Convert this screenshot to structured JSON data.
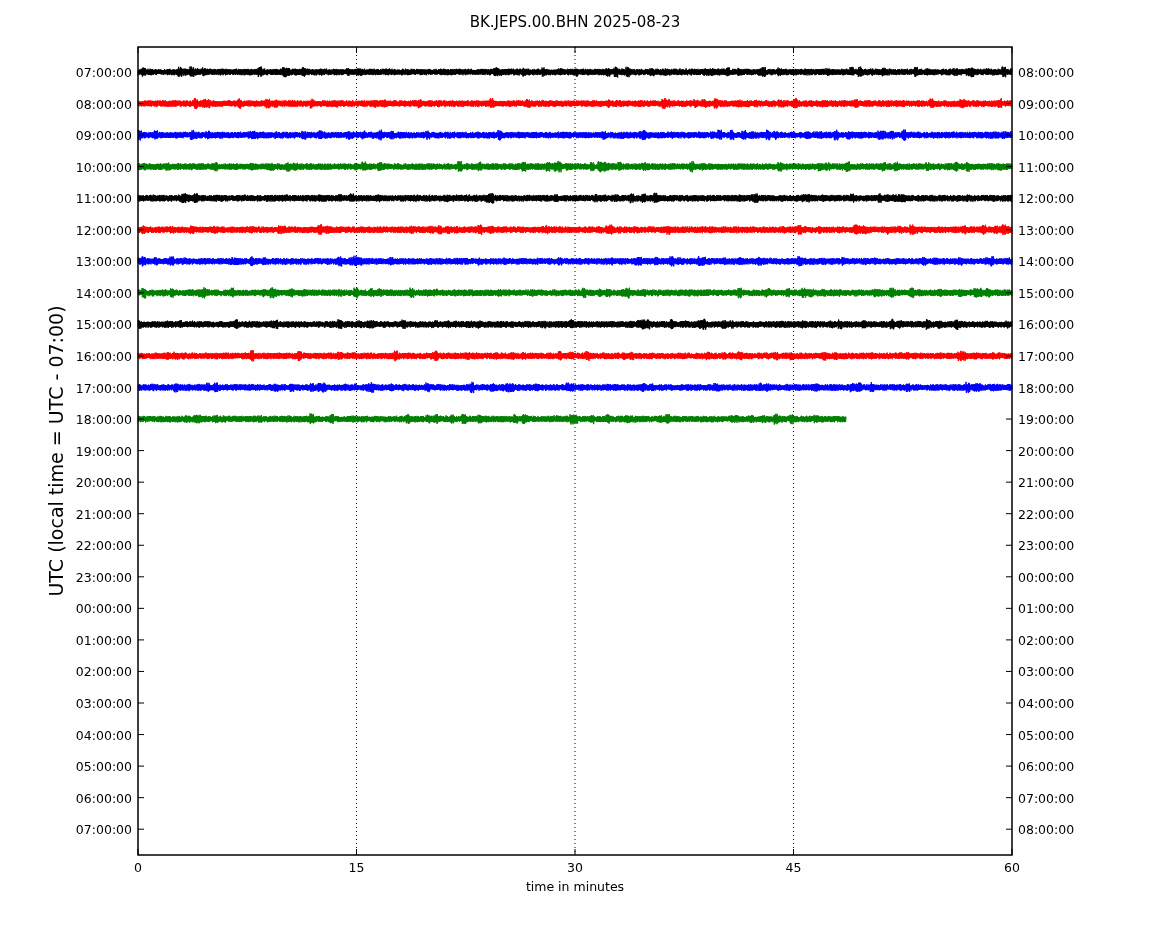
{
  "title": "BK.JEPS.00.BHN 2025-08-23",
  "y_axis_label": "UTC (local time = UTC - 07:00)",
  "x_axis_label": "time in minutes",
  "x_ticks": [
    "0",
    "15",
    "30",
    "45",
    "60"
  ],
  "left_labels": [
    "07:00:00",
    "08:00:00",
    "09:00:00",
    "10:00:00",
    "11:00:00",
    "12:00:00",
    "13:00:00",
    "14:00:00",
    "15:00:00",
    "16:00:00",
    "17:00:00",
    "18:00:00",
    "19:00:00",
    "20:00:00",
    "21:00:00",
    "22:00:00",
    "23:00:00",
    "00:00:00",
    "01:00:00",
    "02:00:00",
    "03:00:00",
    "04:00:00",
    "05:00:00",
    "06:00:00",
    "07:00:00"
  ],
  "right_labels": [
    "08:00:00",
    "09:00:00",
    "10:00:00",
    "11:00:00",
    "12:00:00",
    "13:00:00",
    "14:00:00",
    "15:00:00",
    "16:00:00",
    "17:00:00",
    "18:00:00",
    "19:00:00",
    "20:00:00",
    "21:00:00",
    "22:00:00",
    "23:00:00",
    "00:00:00",
    "01:00:00",
    "02:00:00",
    "03:00:00",
    "04:00:00",
    "05:00:00",
    "06:00:00",
    "07:00:00",
    "08:00:00"
  ],
  "traces": [
    {
      "color": "#000000",
      "complete": true
    },
    {
      "color": "#ff0000",
      "complete": true
    },
    {
      "color": "#0000ff",
      "complete": true
    },
    {
      "color": "#008000",
      "complete": true
    },
    {
      "color": "#000000",
      "complete": true
    },
    {
      "color": "#ff0000",
      "complete": true
    },
    {
      "color": "#0000ff",
      "complete": true
    },
    {
      "color": "#008000",
      "complete": true
    },
    {
      "color": "#000000",
      "complete": true
    },
    {
      "color": "#ff0000",
      "complete": true
    },
    {
      "color": "#0000ff",
      "complete": true
    },
    {
      "color": "#008000",
      "complete": false
    }
  ]
}
